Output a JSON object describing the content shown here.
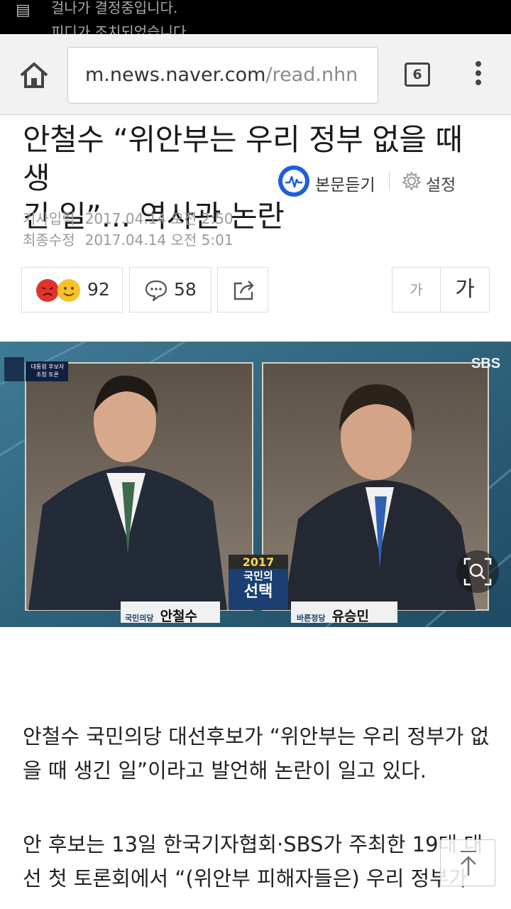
{
  "status_bar": {
    "notification_line1": "걸나가 결정중입니다.",
    "notification_line2": "피디가 조치되었습니다"
  },
  "browser": {
    "url_host": "m.news.naver.com",
    "url_path": "/read.nhn",
    "tab_count": "6",
    "icons": {
      "home": "home-icon",
      "menu": "overflow-menu-icon"
    }
  },
  "article": {
    "headline_line1": "안철수 “위안부는 우리 정부 없을 때 생",
    "headline_line2": "긴 일”… 역사관 논란",
    "listen_label": "본문듣기",
    "settings_label": "설정",
    "published_label": "기사입력",
    "published_value": "2017.04.14 오전 2:50",
    "modified_label": "최종수정",
    "modified_value": "2017.04.14 오전 5:01",
    "reactions_count": "92",
    "comments_count": "58",
    "font_small_label": "가",
    "font_large_label": "가",
    "photo": {
      "channel_logo": "SBS",
      "program_badge_line1": "대통령 후보자",
      "program_badge_line2": "초청 토론",
      "program_year": "2017",
      "program_title_line1": "국민의",
      "program_title_line2": "선택",
      "left_party": "국민의당",
      "left_name": "안철수",
      "right_party": "바른정당",
      "right_name": "유승민"
    },
    "paragraph1": "안철수 국민의당 대선후보가 “위안부는 우리 정부가 없을 때 생긴 일”이라고 발언해 논란이 일고 있다.",
    "paragraph2": "안 후보는 13일 한국기자협회·SBS가 주최한 19대 대선 첫 토론회에서 “(위안부 피해자들은) 우리 정부가"
  },
  "colors": {
    "listen_blue": "#1e5fd8",
    "photo_bg": "#2e5a74",
    "angry_emoji": "#e0342a",
    "smile_emoji": "#f6c12a"
  }
}
